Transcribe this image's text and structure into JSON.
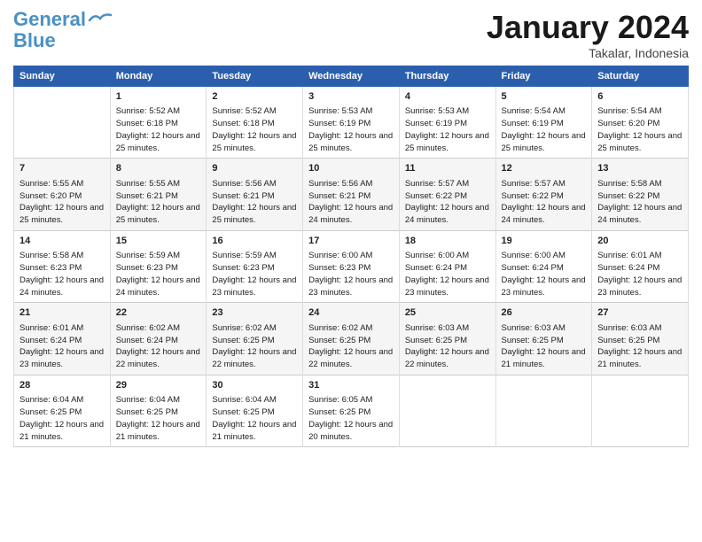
{
  "logo": {
    "line1": "General",
    "line2": "Blue"
  },
  "title": "January 2024",
  "location": "Takalar, Indonesia",
  "days_header": [
    "Sunday",
    "Monday",
    "Tuesday",
    "Wednesday",
    "Thursday",
    "Friday",
    "Saturday"
  ],
  "weeks": [
    [
      {
        "day": "",
        "sunrise": "",
        "sunset": "",
        "daylight": ""
      },
      {
        "day": "1",
        "sunrise": "Sunrise: 5:52 AM",
        "sunset": "Sunset: 6:18 PM",
        "daylight": "Daylight: 12 hours and 25 minutes."
      },
      {
        "day": "2",
        "sunrise": "Sunrise: 5:52 AM",
        "sunset": "Sunset: 6:18 PM",
        "daylight": "Daylight: 12 hours and 25 minutes."
      },
      {
        "day": "3",
        "sunrise": "Sunrise: 5:53 AM",
        "sunset": "Sunset: 6:19 PM",
        "daylight": "Daylight: 12 hours and 25 minutes."
      },
      {
        "day": "4",
        "sunrise": "Sunrise: 5:53 AM",
        "sunset": "Sunset: 6:19 PM",
        "daylight": "Daylight: 12 hours and 25 minutes."
      },
      {
        "day": "5",
        "sunrise": "Sunrise: 5:54 AM",
        "sunset": "Sunset: 6:19 PM",
        "daylight": "Daylight: 12 hours and 25 minutes."
      },
      {
        "day": "6",
        "sunrise": "Sunrise: 5:54 AM",
        "sunset": "Sunset: 6:20 PM",
        "daylight": "Daylight: 12 hours and 25 minutes."
      }
    ],
    [
      {
        "day": "7",
        "sunrise": "Sunrise: 5:55 AM",
        "sunset": "Sunset: 6:20 PM",
        "daylight": "Daylight: 12 hours and 25 minutes."
      },
      {
        "day": "8",
        "sunrise": "Sunrise: 5:55 AM",
        "sunset": "Sunset: 6:21 PM",
        "daylight": "Daylight: 12 hours and 25 minutes."
      },
      {
        "day": "9",
        "sunrise": "Sunrise: 5:56 AM",
        "sunset": "Sunset: 6:21 PM",
        "daylight": "Daylight: 12 hours and 25 minutes."
      },
      {
        "day": "10",
        "sunrise": "Sunrise: 5:56 AM",
        "sunset": "Sunset: 6:21 PM",
        "daylight": "Daylight: 12 hours and 24 minutes."
      },
      {
        "day": "11",
        "sunrise": "Sunrise: 5:57 AM",
        "sunset": "Sunset: 6:22 PM",
        "daylight": "Daylight: 12 hours and 24 minutes."
      },
      {
        "day": "12",
        "sunrise": "Sunrise: 5:57 AM",
        "sunset": "Sunset: 6:22 PM",
        "daylight": "Daylight: 12 hours and 24 minutes."
      },
      {
        "day": "13",
        "sunrise": "Sunrise: 5:58 AM",
        "sunset": "Sunset: 6:22 PM",
        "daylight": "Daylight: 12 hours and 24 minutes."
      }
    ],
    [
      {
        "day": "14",
        "sunrise": "Sunrise: 5:58 AM",
        "sunset": "Sunset: 6:23 PM",
        "daylight": "Daylight: 12 hours and 24 minutes."
      },
      {
        "day": "15",
        "sunrise": "Sunrise: 5:59 AM",
        "sunset": "Sunset: 6:23 PM",
        "daylight": "Daylight: 12 hours and 24 minutes."
      },
      {
        "day": "16",
        "sunrise": "Sunrise: 5:59 AM",
        "sunset": "Sunset: 6:23 PM",
        "daylight": "Daylight: 12 hours and 23 minutes."
      },
      {
        "day": "17",
        "sunrise": "Sunrise: 6:00 AM",
        "sunset": "Sunset: 6:23 PM",
        "daylight": "Daylight: 12 hours and 23 minutes."
      },
      {
        "day": "18",
        "sunrise": "Sunrise: 6:00 AM",
        "sunset": "Sunset: 6:24 PM",
        "daylight": "Daylight: 12 hours and 23 minutes."
      },
      {
        "day": "19",
        "sunrise": "Sunrise: 6:00 AM",
        "sunset": "Sunset: 6:24 PM",
        "daylight": "Daylight: 12 hours and 23 minutes."
      },
      {
        "day": "20",
        "sunrise": "Sunrise: 6:01 AM",
        "sunset": "Sunset: 6:24 PM",
        "daylight": "Daylight: 12 hours and 23 minutes."
      }
    ],
    [
      {
        "day": "21",
        "sunrise": "Sunrise: 6:01 AM",
        "sunset": "Sunset: 6:24 PM",
        "daylight": "Daylight: 12 hours and 23 minutes."
      },
      {
        "day": "22",
        "sunrise": "Sunrise: 6:02 AM",
        "sunset": "Sunset: 6:24 PM",
        "daylight": "Daylight: 12 hours and 22 minutes."
      },
      {
        "day": "23",
        "sunrise": "Sunrise: 6:02 AM",
        "sunset": "Sunset: 6:25 PM",
        "daylight": "Daylight: 12 hours and 22 minutes."
      },
      {
        "day": "24",
        "sunrise": "Sunrise: 6:02 AM",
        "sunset": "Sunset: 6:25 PM",
        "daylight": "Daylight: 12 hours and 22 minutes."
      },
      {
        "day": "25",
        "sunrise": "Sunrise: 6:03 AM",
        "sunset": "Sunset: 6:25 PM",
        "daylight": "Daylight: 12 hours and 22 minutes."
      },
      {
        "day": "26",
        "sunrise": "Sunrise: 6:03 AM",
        "sunset": "Sunset: 6:25 PM",
        "daylight": "Daylight: 12 hours and 21 minutes."
      },
      {
        "day": "27",
        "sunrise": "Sunrise: 6:03 AM",
        "sunset": "Sunset: 6:25 PM",
        "daylight": "Daylight: 12 hours and 21 minutes."
      }
    ],
    [
      {
        "day": "28",
        "sunrise": "Sunrise: 6:04 AM",
        "sunset": "Sunset: 6:25 PM",
        "daylight": "Daylight: 12 hours and 21 minutes."
      },
      {
        "day": "29",
        "sunrise": "Sunrise: 6:04 AM",
        "sunset": "Sunset: 6:25 PM",
        "daylight": "Daylight: 12 hours and 21 minutes."
      },
      {
        "day": "30",
        "sunrise": "Sunrise: 6:04 AM",
        "sunset": "Sunset: 6:25 PM",
        "daylight": "Daylight: 12 hours and 21 minutes."
      },
      {
        "day": "31",
        "sunrise": "Sunrise: 6:05 AM",
        "sunset": "Sunset: 6:25 PM",
        "daylight": "Daylight: 12 hours and 20 minutes."
      },
      {
        "day": "",
        "sunrise": "",
        "sunset": "",
        "daylight": ""
      },
      {
        "day": "",
        "sunrise": "",
        "sunset": "",
        "daylight": ""
      },
      {
        "day": "",
        "sunrise": "",
        "sunset": "",
        "daylight": ""
      }
    ]
  ]
}
